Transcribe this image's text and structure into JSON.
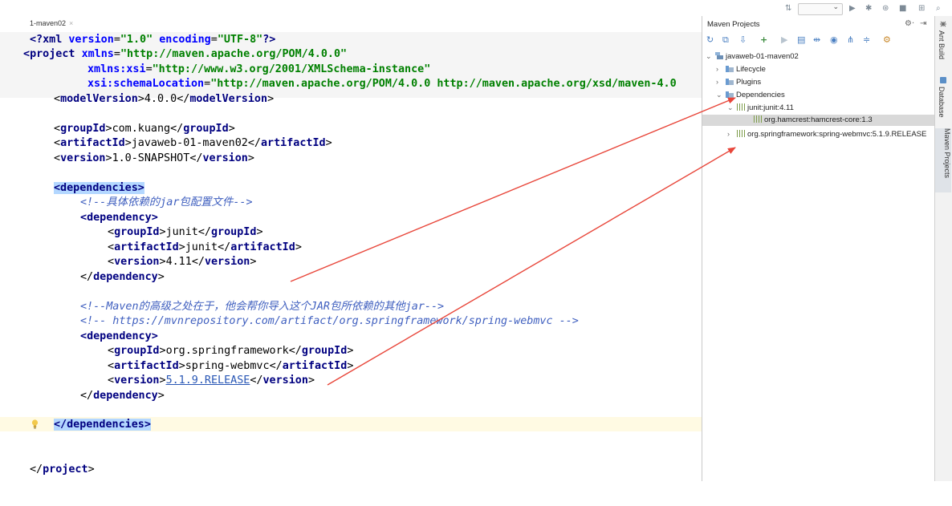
{
  "toolbar": {
    "sort_icon_glyph": "⇅",
    "run_config_arrow": "⌄",
    "icons": [
      "run-icon",
      "debug-icon",
      "coverage-icon",
      "stop-icon",
      "project-structure-icon",
      "search-icon"
    ],
    "icon_glyphs": [
      "▶",
      "✱",
      "⊛",
      "■",
      "⊞",
      "⌕"
    ]
  },
  "editor": {
    "tab_label": "1-maven02",
    "tab_close": "×",
    "fold_glyph": "⌄",
    "lines": {
      "l1": [
        "<?",
        "xml ",
        "version",
        "=",
        "\"1.0\"",
        " ",
        "encoding",
        "=",
        "\"UTF-8\"",
        "?>"
      ],
      "l2": [
        "<",
        "project ",
        "xmlns",
        "=",
        "\"http://maven.apache.org/POM/4.0.0\""
      ],
      "l3": [
        "xmlns:xsi",
        "=",
        "\"http://www.w3.org/2001/XMLSchema-instance\""
      ],
      "l4": [
        "xsi:schemaLocation",
        "=",
        "\"http://maven.apache.org/POM/4.0.0 http://maven.apache.org/xsd/maven-4.0"
      ],
      "l5": [
        "<",
        "modelVersion",
        ">",
        "4.0.0",
        "</",
        "modelVersion",
        ">"
      ],
      "l7": [
        "<",
        "groupId",
        ">",
        "com.kuang",
        "</",
        "groupId",
        ">"
      ],
      "l8": [
        "<",
        "artifactId",
        ">",
        "javaweb-01-maven02",
        "</",
        "artifactId",
        ">"
      ],
      "l9": [
        "<",
        "version",
        ">",
        "1.0-SNAPSHOT",
        "</",
        "version",
        ">"
      ],
      "l11": [
        "<dependencies>"
      ],
      "l12": [
        "<!--具体依赖的jar包配置文件-->"
      ],
      "l13": [
        "<",
        "dependency",
        ">"
      ],
      "l14": [
        "<",
        "groupId",
        ">",
        "junit",
        "</",
        "groupId",
        ">"
      ],
      "l15": [
        "<",
        "artifactId",
        ">",
        "junit",
        "</",
        "artifactId",
        ">"
      ],
      "l16": [
        "<",
        "version",
        ">",
        "4.11",
        "</",
        "version",
        ">"
      ],
      "l17": [
        "</",
        "dependency",
        ">"
      ],
      "l19": [
        "<!--Maven的高级之处在于，他会帮你导入这个JAR包所依赖的其他jar-->"
      ],
      "l20": [
        "<!-- https://mvnrepository.com/artifact/org.springframework/spring-webmvc -->"
      ],
      "l21": [
        "<",
        "dependency",
        ">"
      ],
      "l22": [
        "<",
        "groupId",
        ">",
        "org.springframework",
        "</",
        "groupId",
        ">"
      ],
      "l23": [
        "<",
        "artifactId",
        ">",
        "spring-webmvc",
        "</",
        "artifactId",
        ">"
      ],
      "l24": [
        "<",
        "version",
        ">",
        "5.1.9.RELEASE",
        "</",
        "version",
        ">"
      ],
      "l25": [
        "</",
        "dependency",
        ">"
      ],
      "l27": [
        "</dependencies>"
      ],
      "l30": [
        "</",
        "project",
        ">"
      ]
    }
  },
  "maven_panel": {
    "title": "Maven Projects",
    "gear": "⚙·",
    "hide": "⇥",
    "toolbar_icons": [
      "reimport-icon",
      "generate-sources-icon",
      "download-icon",
      "add-icon",
      "run-icon",
      "execute-goal-icon",
      "toggle-offline-icon",
      "skip-tests-icon",
      "show-dependencies-icon",
      "collapse-all-icon",
      "settings-icon"
    ],
    "toolbar_glyphs": [
      "↻",
      "⧉",
      "⇩",
      "+",
      "▶",
      "▤",
      "⇹",
      "◉",
      "⋔",
      "≑",
      "⚙"
    ],
    "tree": {
      "project": "javaweb-01-maven02",
      "lifecycle": "Lifecycle",
      "plugins": "Plugins",
      "dependencies": "Dependencies",
      "junit": "junit:junit:4.11",
      "hamcrest": "org.hamcrest:hamcrest-core:1.3",
      "spring": "org.springframework:spring-webmvc:5.1.9.RELEASE"
    },
    "arrows": {
      "expanded": "⌄",
      "collapsed": "›"
    }
  },
  "right_strip": {
    "ant_build": "Ant Build",
    "database": "Database",
    "maven_projects": "Maven Projects"
  },
  "colors": {
    "tag": "#000080",
    "attr_name": "#0000ff",
    "attr_value": "#008000",
    "comment": "#3f5fbf",
    "selection": "#b3d7ff",
    "annotation_arrow": "#e8463a"
  }
}
